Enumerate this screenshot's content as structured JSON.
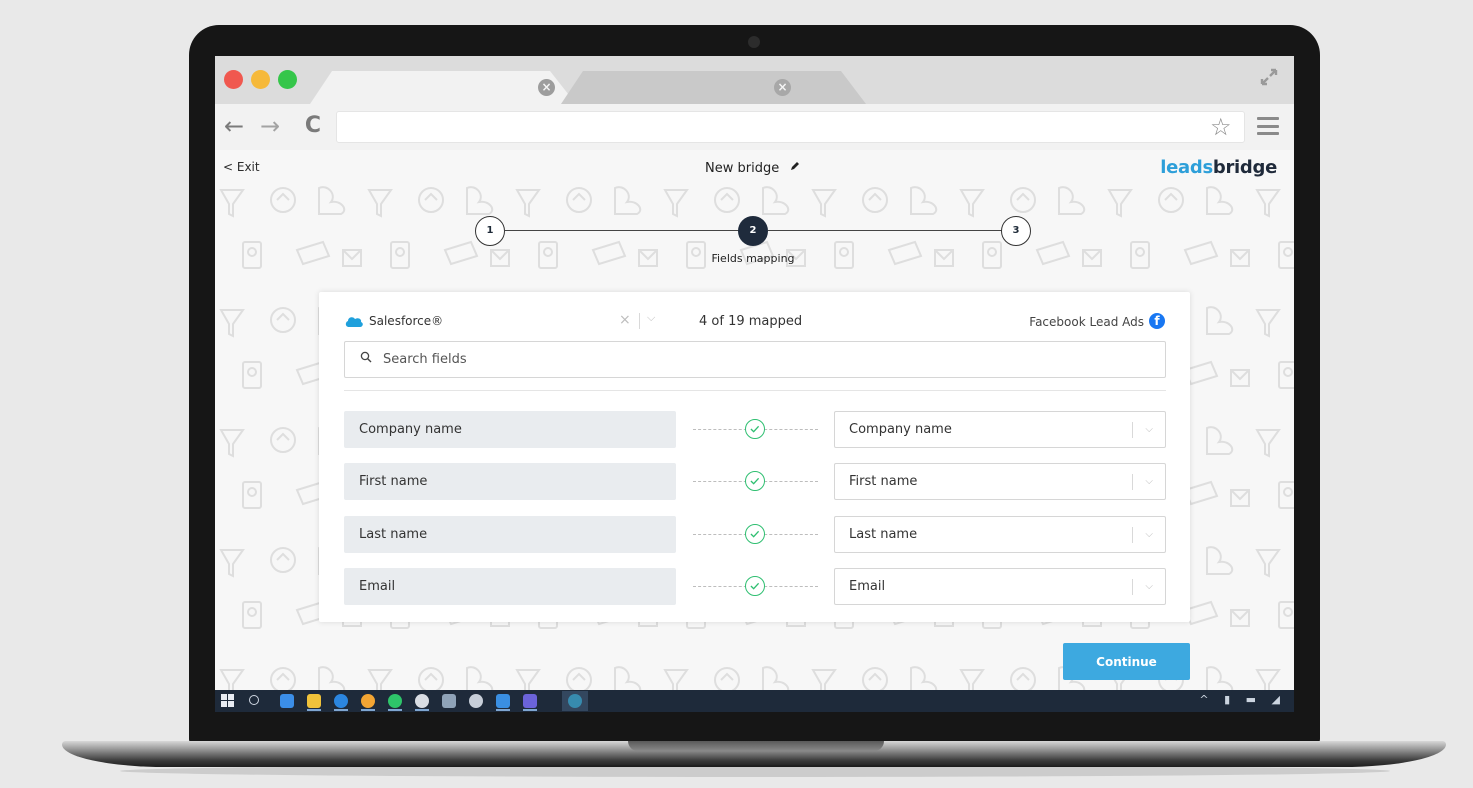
{
  "browser": {
    "tabs": [
      {
        "label": "",
        "close": "×"
      },
      {
        "label": "",
        "close": "×"
      }
    ],
    "address": "",
    "icons": {
      "back": "arrow-left-icon",
      "forward": "arrow-right-icon",
      "reload": "reload-icon",
      "star": "star-icon",
      "menu": "hamburger-menu-icon",
      "expand": "expand-icon"
    }
  },
  "header": {
    "exit_label": "< Exit",
    "bridge_title": "New bridge",
    "logo_leads": "leads",
    "logo_bridge": "bridge"
  },
  "stepper": {
    "steps": [
      "1",
      "2",
      "3"
    ],
    "current_index": 2,
    "current_label": "Fields mapping"
  },
  "mapping": {
    "source_name": "Salesforce®",
    "clear_symbol": "×",
    "chevron_symbol": "⌵",
    "mapped_count": "4 of 19 mapped",
    "destination_name": "Facebook Lead Ads",
    "search_placeholder": "Search fields",
    "rows": [
      {
        "source": "Company name",
        "destination": "Company name"
      },
      {
        "source": "First name",
        "destination": "First name"
      },
      {
        "source": "Last name",
        "destination": "Last name"
      },
      {
        "source": "Email",
        "destination": "Email"
      }
    ]
  },
  "actions": {
    "continue_label": "Continue"
  },
  "colors": {
    "accent": "#3da9e0",
    "logo_blue": "#2d9fd9",
    "logo_dark": "#1f2a3a",
    "check_green": "#2fbf71",
    "step_dark": "#1f2b3c",
    "facebook": "#1877f2"
  }
}
